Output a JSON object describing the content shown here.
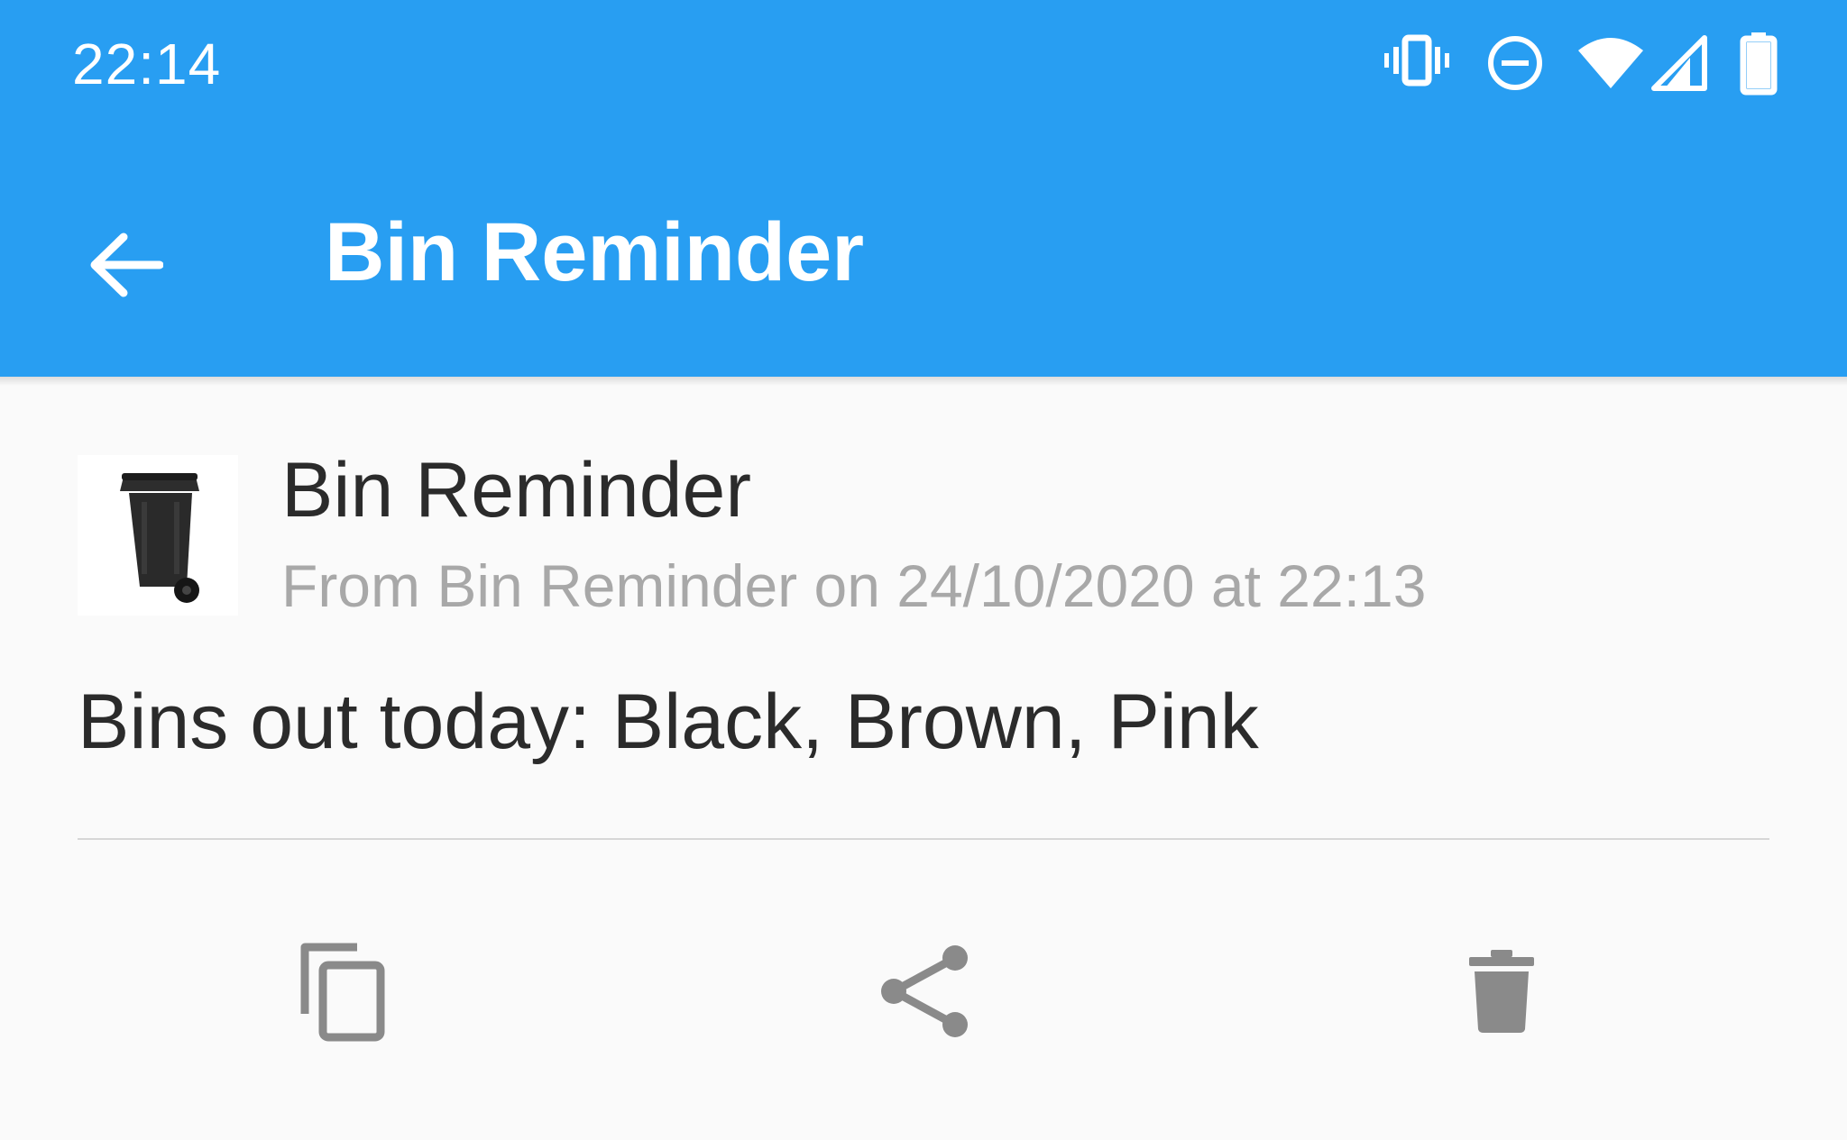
{
  "status_bar": {
    "time": "22:14",
    "icons": [
      "vibrate-icon",
      "do-not-disturb-icon",
      "wifi-icon",
      "cell-signal-icon",
      "battery-icon"
    ]
  },
  "app_bar": {
    "title": "Bin Reminder",
    "back_icon": "arrow-back-icon"
  },
  "notification": {
    "icon": "wheelie-bin-icon",
    "title": "Bin Reminder",
    "meta": "From Bin Reminder on 24/10/2020 at 22:13",
    "body": "Bins out today: Black, Brown, Pink"
  },
  "actions": [
    {
      "icon": "copy-icon"
    },
    {
      "icon": "share-icon"
    },
    {
      "icon": "delete-icon"
    }
  ],
  "colors": {
    "app_bar": "#289ef2",
    "background": "#fafafa",
    "primary_text": "#2b2b2b",
    "secondary_text": "#a8a8a8",
    "action_icon": "#8a8a8a"
  }
}
